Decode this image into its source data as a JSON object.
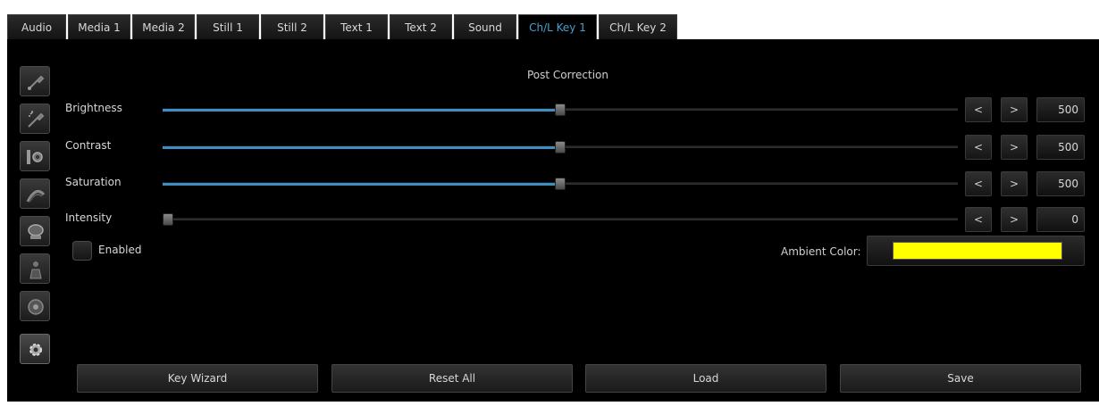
{
  "tabs": [
    {
      "label": "Audio",
      "active": false
    },
    {
      "label": "Media 1",
      "active": false
    },
    {
      "label": "Media 2",
      "active": false
    },
    {
      "label": "Still 1",
      "active": false
    },
    {
      "label": "Still 2",
      "active": false
    },
    {
      "label": "Text 1",
      "active": false
    },
    {
      "label": "Text 2",
      "active": false
    },
    {
      "label": "Sound",
      "active": false
    },
    {
      "label": "Ch/L Key 1",
      "active": true
    },
    {
      "label": "Ch/L Key 2",
      "active": false
    }
  ],
  "sidebar": {
    "icons": [
      "eyedropper-icon",
      "eyedropper-wand-icon",
      "gear-adjust-icon",
      "gradient-icon",
      "lens-icon",
      "figure-icon",
      "flower-icon",
      "settings-icon"
    ],
    "active_index": 7
  },
  "post_correction": {
    "title": "Post Correction",
    "decrement_label": "<",
    "increment_label": ">",
    "rows": [
      {
        "label": "Brightness",
        "value": "500",
        "fraction": 0.5
      },
      {
        "label": "Contrast",
        "value": "500",
        "fraction": 0.5
      },
      {
        "label": "Saturation",
        "value": "500",
        "fraction": 0.5
      },
      {
        "label": "Intensity",
        "value": "0",
        "fraction": 0.0
      }
    ]
  },
  "enabled": {
    "label": "Enabled",
    "checked": false
  },
  "ambient": {
    "label": "Ambient Color:",
    "color": "#ffff00"
  },
  "buttons": {
    "key_wizard": "Key Wizard",
    "reset_all": "Reset All",
    "load": "Load",
    "save": "Save"
  },
  "colors": {
    "accent": "#3c8ec3",
    "active_tab_text": "#4a9fd0",
    "panel_bg": "#000000"
  }
}
